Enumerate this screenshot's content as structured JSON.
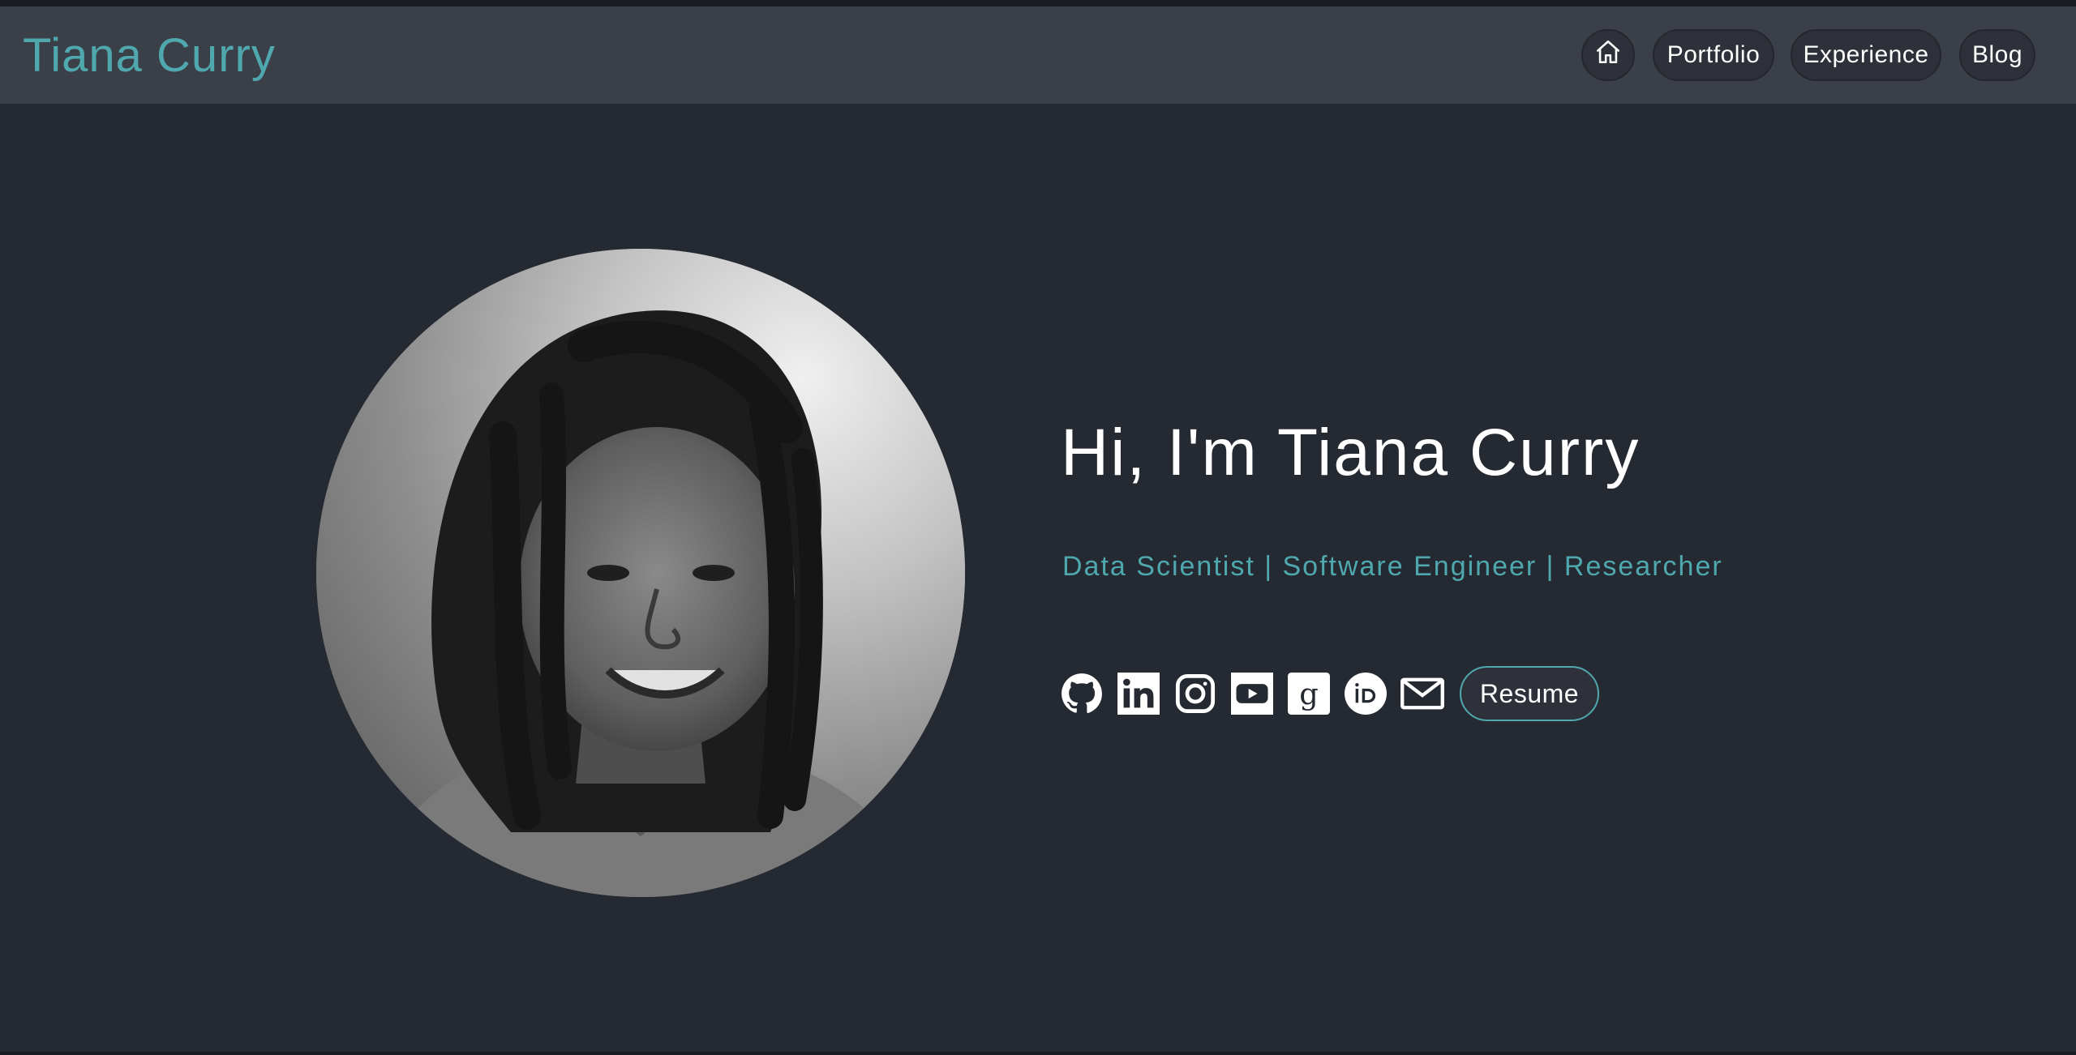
{
  "header": {
    "brand": "Tiana Curry",
    "nav": [
      {
        "label": "",
        "icon": "home-icon"
      },
      {
        "label": "Portfolio"
      },
      {
        "label": "Experience"
      },
      {
        "label": "Blog"
      }
    ]
  },
  "hero": {
    "greeting": "Hi, I'm Tiana Curry",
    "subtitle": "Data Scientist | Software Engineer | Researcher",
    "socials": [
      {
        "icon": "github-icon"
      },
      {
        "icon": "linkedin-icon"
      },
      {
        "icon": "instagram-icon"
      },
      {
        "icon": "youtube-icon"
      },
      {
        "icon": "google-scholar-icon"
      },
      {
        "icon": "orcid-icon"
      },
      {
        "icon": "email-icon"
      }
    ],
    "resume_label": "Resume"
  },
  "colors": {
    "accent": "#4ea8ad",
    "background": "#252932",
    "navbar": "#3b3f48",
    "pill": "#2e3139",
    "text": "#ffffff"
  }
}
